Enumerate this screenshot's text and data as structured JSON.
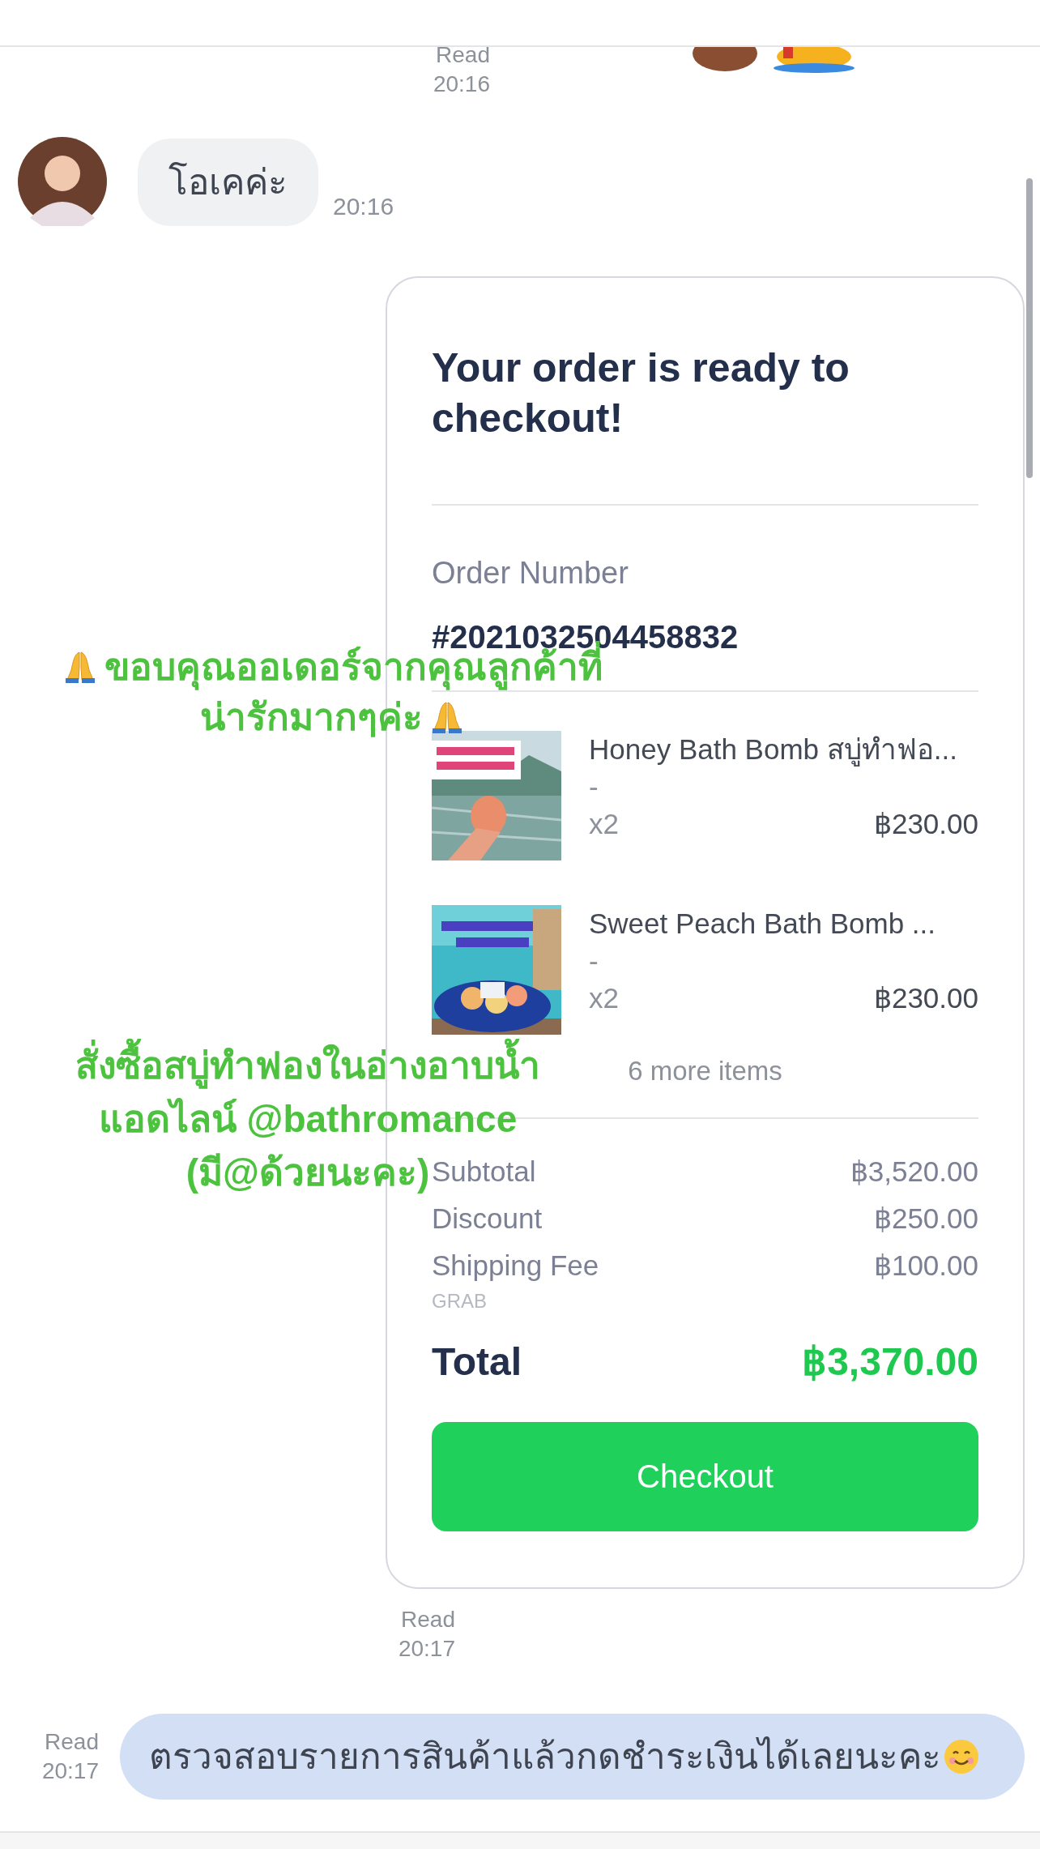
{
  "top_receipt": {
    "status": "Read",
    "time": "20:16"
  },
  "incoming": {
    "text": "โอเคค่ะ",
    "time": "20:16"
  },
  "order_card": {
    "title": "Your order is ready to checkout!",
    "order_label": "Order Number",
    "order_number": "#2021032504458832",
    "items": [
      {
        "kind": "picture",
        "name": "Honey Bath Bomb สบู่ทำฟอ...",
        "variant": "-",
        "qty": "x2",
        "price": "฿230.00"
      },
      {
        "kind": "picture",
        "name": "Sweet Peach Bath Bomb ...",
        "variant": "-",
        "qty": "x2",
        "price": "฿230.00"
      }
    ],
    "more": "6 more items",
    "summary": [
      {
        "label": "Subtotal",
        "value": "฿3,520.00"
      },
      {
        "label": "Discount",
        "value": "฿250.00"
      },
      {
        "label": "Shipping Fee",
        "value": "฿100.00",
        "note": "GRAB"
      }
    ],
    "total_label": "Total",
    "total_value": "฿3,370.00",
    "button": "Checkout"
  },
  "card_receipt": {
    "status": "Read",
    "time": "20:17"
  },
  "outgoing": {
    "text": "ตรวจสอบรายการสินค้าแล้วกดชำระเงินได้เลยนะคะ",
    "status": "Read",
    "time": "20:17"
  },
  "overlays": [
    {
      "lines": [
        "ขอบคุณออเดอร์จากคุณลูกค้าที่",
        "น่ารักมากๆค่ะ"
      ]
    },
    {
      "lines": [
        "สั่งซื้อสบู่ทำฟองในอ่างอาบน้ำ",
        "แอดไลน์ @bathromance",
        "(มี@ด้วยนะคะ)"
      ]
    }
  ]
}
